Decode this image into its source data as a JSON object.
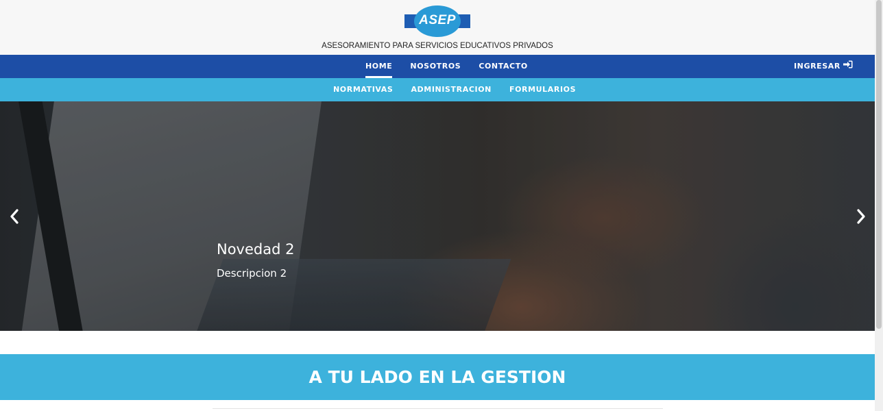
{
  "header": {
    "logo_text": "ASEP",
    "tagline": "ASESORAMIENTO PARA SERVICIOS EDUCATIVOS PRIVADOS"
  },
  "nav_primary": {
    "items": [
      {
        "label": "HOME",
        "active": true
      },
      {
        "label": "NOSOTROS",
        "active": false
      },
      {
        "label": "CONTACTO",
        "active": false
      }
    ],
    "login_label": "INGRESAR",
    "login_icon": "sign-in-icon"
  },
  "nav_secondary": {
    "items": [
      {
        "label": "NORMATIVAS"
      },
      {
        "label": "ADMINISTRACION"
      },
      {
        "label": "FORMULARIOS"
      }
    ]
  },
  "carousel": {
    "slide_title": "Novedad 2",
    "slide_description": "Descripcion 2",
    "prev_icon": "chevron-left-icon",
    "next_icon": "chevron-right-icon"
  },
  "banner": {
    "title": "A TU LADO EN LA GESTION"
  },
  "colors": {
    "primary_nav": "#1d4ea6",
    "secondary_nav": "#3db2dc",
    "header_bg": "#f7f7f7",
    "logo_stripe": "#1e5db3",
    "logo_oval": "#2a9ad6"
  }
}
